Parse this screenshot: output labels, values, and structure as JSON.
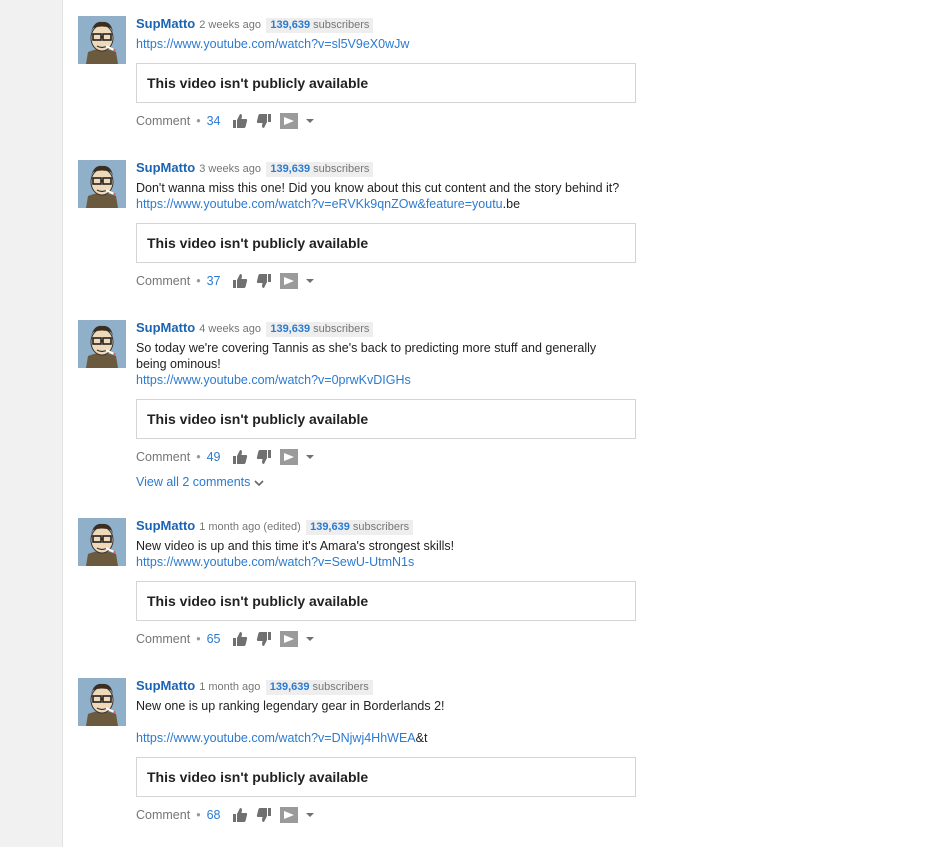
{
  "posts": [
    {
      "author": "SupMatto",
      "time": "2 weeks ago",
      "subs_count": "139,639",
      "subs_label": "subscribers",
      "text_lines": [],
      "link": "https://www.youtube.com/watch?v=sl5V9eX0wJw",
      "link_suffix": "",
      "card": "This video isn't publicly available",
      "comment_label": "Comment",
      "likes": "34"
    },
    {
      "author": "SupMatto",
      "time": "3 weeks ago",
      "subs_count": "139,639",
      "subs_label": "subscribers",
      "text_lines": [
        "Don't wanna miss this one! Did you know about this cut content and the story behind it?"
      ],
      "link": "https://www.youtube.com/watch?v=eRVKk9qnZOw&feature=youtu",
      "link_suffix": ".be",
      "card": "This video isn't publicly available",
      "comment_label": "Comment",
      "likes": "37"
    },
    {
      "author": "SupMatto",
      "time": "4 weeks ago",
      "subs_count": "139,639",
      "subs_label": "subscribers",
      "text_lines": [
        "So today we're covering Tannis as she's back to predicting more stuff and generally",
        "being ominous!"
      ],
      "link": "https://www.youtube.com/watch?v=0prwKvDIGHs",
      "link_suffix": "",
      "card": "This video isn't publicly available",
      "comment_label": "Comment",
      "likes": "49"
    },
    {
      "author": "SupMatto",
      "time": "1 month ago (edited)",
      "subs_count": "139,639",
      "subs_label": "subscribers",
      "text_lines": [
        "New video is up and this time it's Amara's strongest skills!"
      ],
      "link": "https://www.youtube.com/watch?v=SewU-UtmN1s",
      "link_suffix": "",
      "card": "This video isn't publicly available",
      "comment_label": "Comment",
      "likes": "65"
    },
    {
      "author": "SupMatto",
      "time": "1 month ago",
      "subs_count": "139,639",
      "subs_label": "subscribers",
      "text_lines": [
        "New one is up ranking legendary gear in Borderlands 2!",
        ""
      ],
      "link": "https://www.youtube.com/watch?v=DNjwj4HhWEA",
      "link_suffix": "&t",
      "card": "This video isn't publicly available",
      "comment_label": "Comment",
      "likes": "68"
    }
  ],
  "view_all": "View all 2 comments",
  "colors": {
    "link": "#2b7bd1",
    "author": "#1a64b4",
    "muted": "#767676"
  },
  "icons": [
    "avatar",
    "thumbs-up-icon",
    "thumbs-down-icon",
    "share-icon",
    "caret-down-icon",
    "chevron-down-icon"
  ]
}
